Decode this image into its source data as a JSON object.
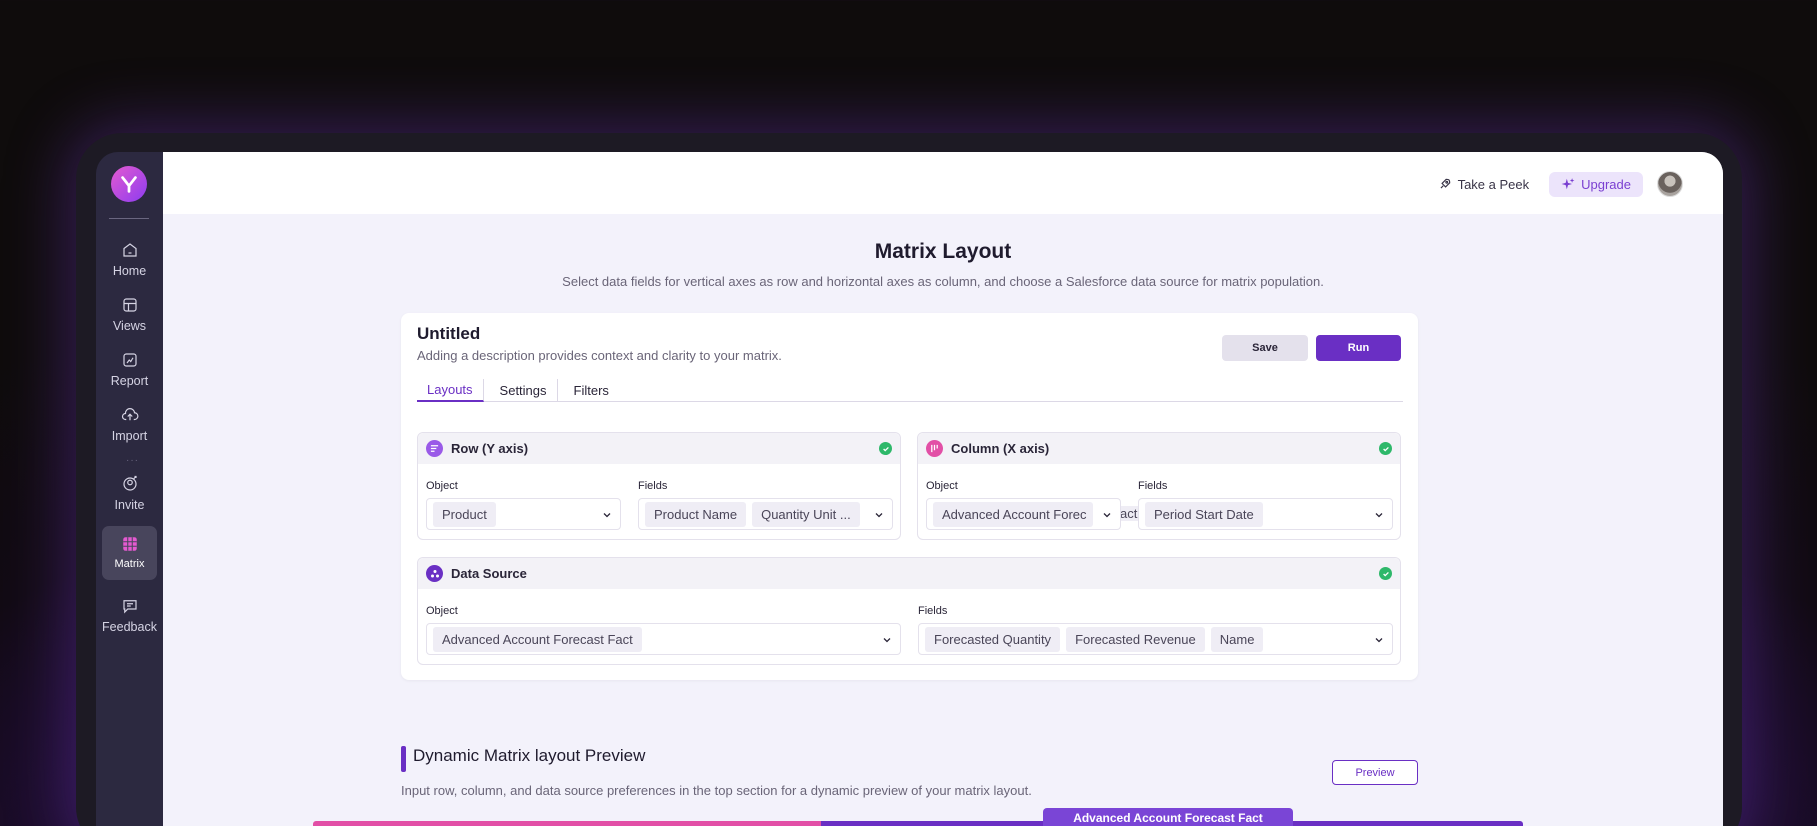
{
  "sidebar": {
    "items": [
      {
        "label": "Home",
        "icon": "home-icon"
      },
      {
        "label": "Views",
        "icon": "views-icon"
      },
      {
        "label": "Report",
        "icon": "report-icon"
      },
      {
        "label": "Import",
        "icon": "import-icon"
      },
      {
        "label": "Invite",
        "icon": "invite-icon"
      },
      {
        "label": "Matrix",
        "icon": "matrix-icon",
        "active": true
      },
      {
        "label": "Feedback",
        "icon": "feedback-icon"
      }
    ]
  },
  "topbar": {
    "peek_label": "Take a Peek",
    "upgrade_label": "Upgrade"
  },
  "header": {
    "title": "Matrix Layout",
    "subtitle": "Select data fields for vertical axes as row and horizontal axes as column, and choose a Salesforce data source for matrix population."
  },
  "card": {
    "title": "Untitled",
    "description": "Adding a description provides context and clarity to your matrix.",
    "save_label": "Save",
    "run_label": "Run",
    "tabs": [
      {
        "label": "Layouts",
        "active": true
      },
      {
        "label": "Settings"
      },
      {
        "label": "Filters"
      }
    ]
  },
  "row_panel": {
    "title": "Row  (Y axis)",
    "object_label": "Object",
    "object_value": "Product",
    "fields_label": "Fields",
    "fields": [
      "Product Name",
      "Quantity Unit ..."
    ]
  },
  "column_panel": {
    "title": "Column (X axis)",
    "object_label": "Object",
    "object_value": "Advanced Account Forec",
    "object_overflow": "act",
    "fields_label": "Fields",
    "fields": [
      "Period Start Date"
    ]
  },
  "datasource_panel": {
    "title": "Data Source",
    "object_label": "Object",
    "object_value": "Advanced Account Forecast Fact",
    "fields_label": "Fields",
    "fields": [
      "Forecasted Quantity",
      "Forecasted Revenue",
      "Name"
    ]
  },
  "preview": {
    "title": "Dynamic Matrix layout Preview",
    "subtitle": "Input row, column, and data source preferences in the top section for a dynamic preview of your matrix layout.",
    "button_label": "Preview",
    "tag_label": "Advanced Account Forecast Fact"
  },
  "colors": {
    "accent": "#6a2fc4",
    "pink": "#e24fa6",
    "success": "#2eb86a"
  }
}
